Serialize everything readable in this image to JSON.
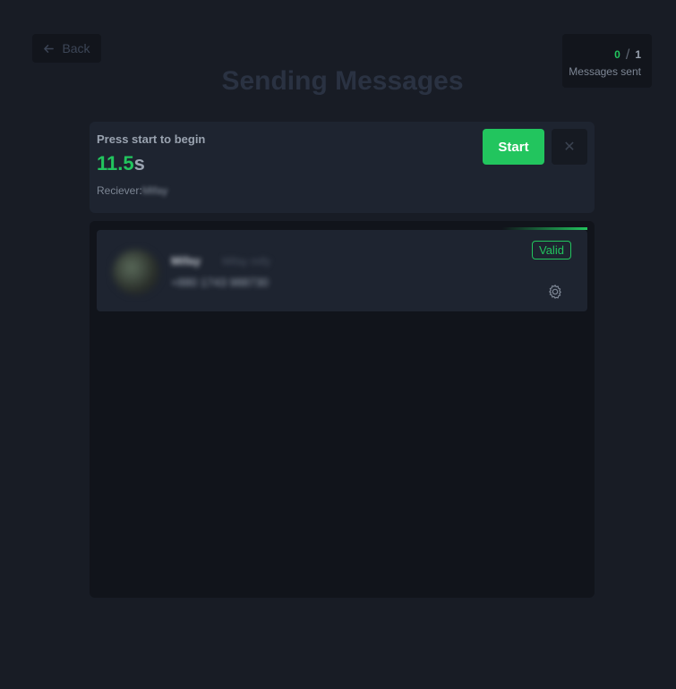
{
  "header": {
    "back_label": "Back",
    "title": "Sending Messages",
    "counter": {
      "sent": "0",
      "total": "1",
      "caption": "Messages sent"
    }
  },
  "control": {
    "status": "Press start to begin",
    "timer_value": "11.5",
    "timer_unit": "s",
    "receiver_label": "Reciever:",
    "receiver_name": "Mifay",
    "start_label": "Start",
    "close_symbol": "✕"
  },
  "contacts": [
    {
      "name": "Mifay",
      "subtitle": "Mifay mify",
      "phone": "+880 1743 988730",
      "badge": "Valid",
      "icons": [
        "avatar",
        "gear-icon"
      ]
    }
  ],
  "colors": {
    "accent": "#22c55e",
    "background": "#181c25",
    "card": "#1e2430",
    "panel": "#11141b"
  }
}
